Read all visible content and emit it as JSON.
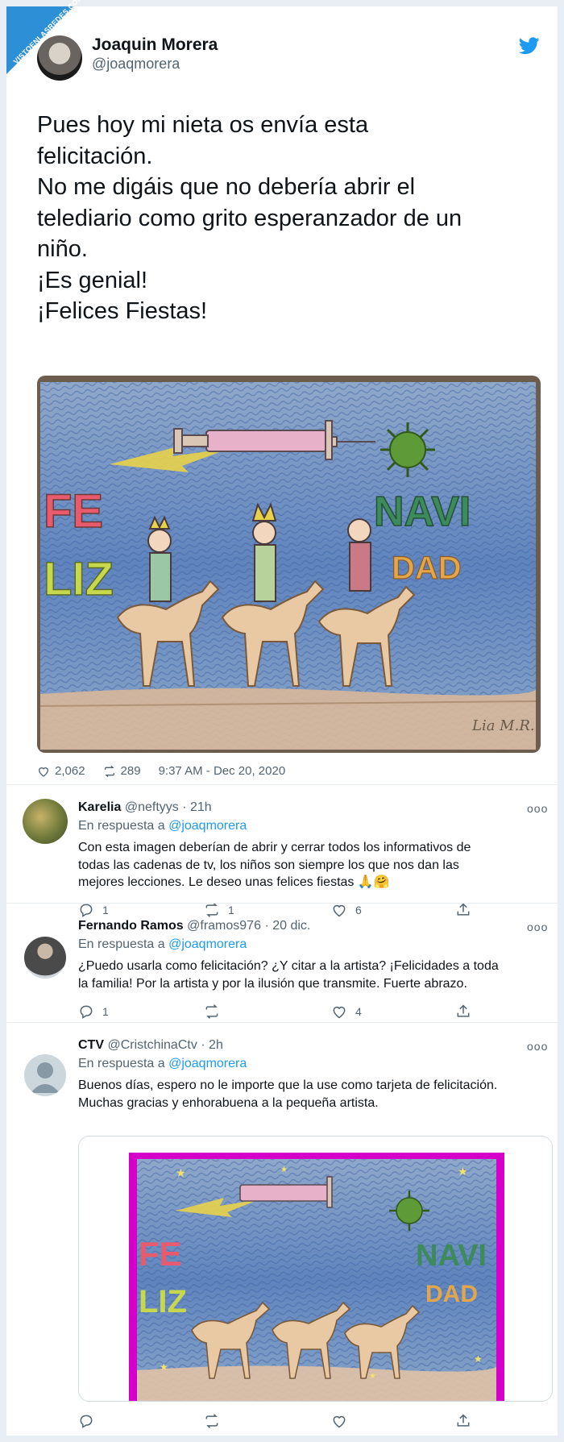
{
  "watermark": "VISTOENLASREDES.COM",
  "main_tweet": {
    "name": "Joaquin Morera",
    "handle": "@joaqmorera",
    "text_lines": [
      "Pues hoy mi nieta os envía esta",
      "felicitación.",
      "No me digáis que no debería abrir el",
      "telediario como grito esperanzador de un",
      "niño.",
      "¡Es genial!",
      "¡Felices Fiestas!"
    ],
    "image": {
      "words_left_top": "FE",
      "words_left_bottom": "LIZ",
      "words_right_top": "NAVI",
      "words_right_bottom": "DAD",
      "signature": "Lia M.R."
    },
    "likes": "2,062",
    "retweets": "289",
    "timestamp": "9:37 AM - Dec 20, 2020"
  },
  "replies": [
    {
      "name": "Karelia",
      "handle": "@neftyys",
      "age": "· 21h",
      "in_reply_prefix": "En respuesta a",
      "in_reply_to": "@joaqmorera",
      "text_lines": [
        "Con esta imagen deberían de abrir y cerrar todos los informativos de",
        "todas las cadenas de tv, los niños son siempre los que nos dan las",
        "mejores lecciones. Le deseo unas felices fiestas 🙏🤗"
      ],
      "reply_count": "1",
      "retweet_count": "1",
      "like_count": "6"
    },
    {
      "name": "Fernando Ramos",
      "handle": "@framos976",
      "age": "· 20 dic.",
      "in_reply_prefix": "En respuesta a",
      "in_reply_to": "@joaqmorera",
      "text_lines": [
        "¿Puedo usarla como felicitación? ¿Y citar a la artista? ¡Felicidades a toda",
        "la familia! Por la artista y por la ilusión que transmite. Fuerte abrazo."
      ],
      "reply_count": "1",
      "retweet_count": "",
      "like_count": "4"
    },
    {
      "name": "CTV",
      "handle": "@CristchinaCtv",
      "age": "· 2h",
      "in_reply_prefix": "En respuesta a",
      "in_reply_to": "@joaqmorera",
      "text_lines": [
        "Buenos días, espero no le importe que la use como tarjeta de felicitación.",
        "Muchas gracias y enhorabuena a la pequeña artista."
      ],
      "reply_count": "",
      "retweet_count": "",
      "like_count": ""
    }
  ],
  "more_label": "ooo",
  "colors": {
    "link": "#1d9bf0",
    "muted": "#536471",
    "text": "#0f1419",
    "twitter_blue": "#1d9bf0",
    "frame_magenta": "#d400c9"
  },
  "icons": [
    "twitter-bird-icon",
    "heart-icon",
    "retweet-icon",
    "reply-icon",
    "share-icon",
    "more-icon"
  ]
}
